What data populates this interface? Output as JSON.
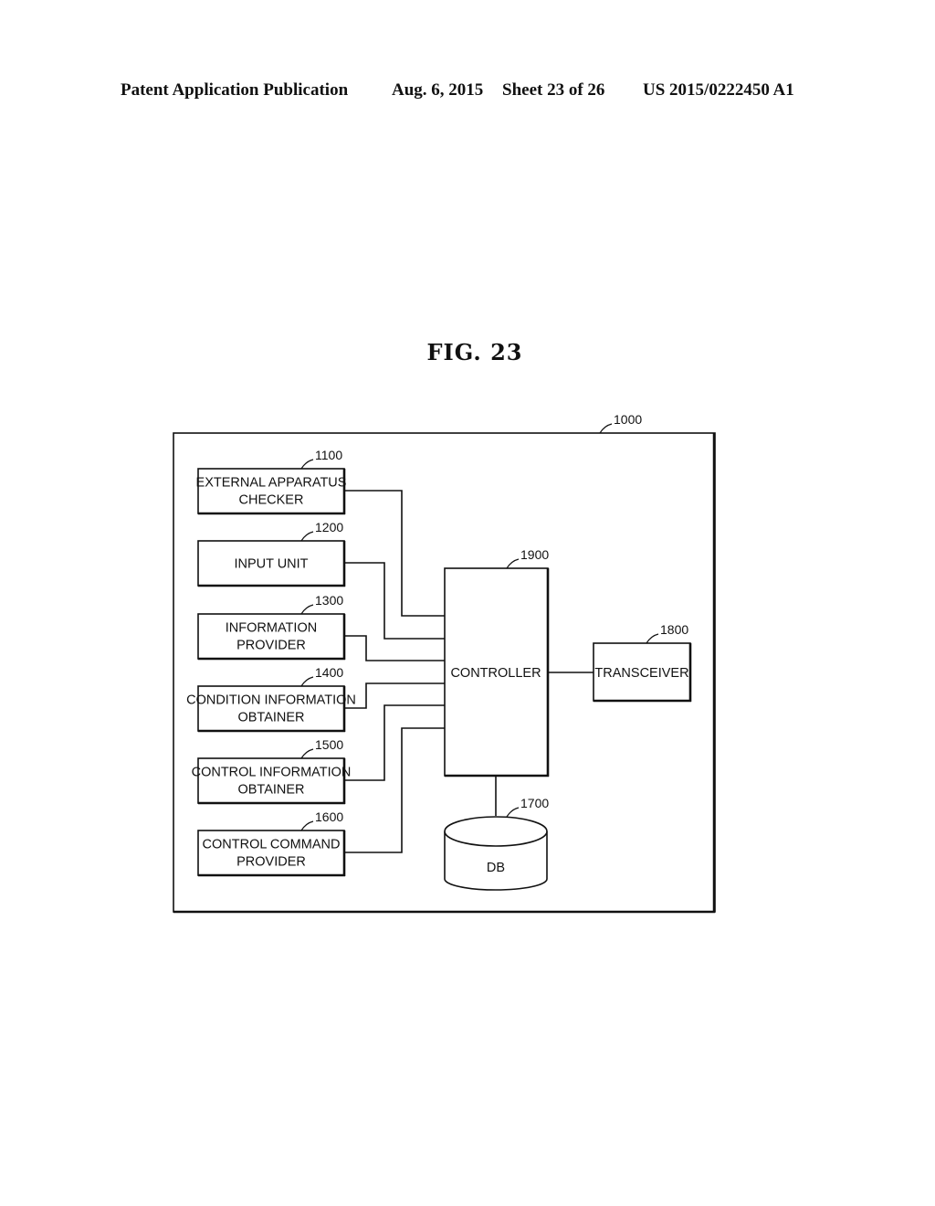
{
  "header": {
    "publication": "Patent Application Publication",
    "date": "Aug. 6, 2015",
    "sheet": "Sheet 23 of 26",
    "number": "US 2015/0222450 A1"
  },
  "figure": {
    "title": "FIG.  23",
    "system": {
      "ref": "1000"
    },
    "modules": [
      {
        "ref": "1100",
        "lines": [
          "EXTERNAL APPARATUS",
          "CHECKER"
        ]
      },
      {
        "ref": "1200",
        "lines": [
          "INPUT UNIT"
        ]
      },
      {
        "ref": "1300",
        "lines": [
          "INFORMATION",
          "PROVIDER"
        ]
      },
      {
        "ref": "1400",
        "lines": [
          "CONDITION INFORMATION",
          "OBTAINER"
        ]
      },
      {
        "ref": "1500",
        "lines": [
          "CONTROL INFORMATION",
          "OBTAINER"
        ]
      },
      {
        "ref": "1600",
        "lines": [
          "CONTROL COMMAND",
          "PROVIDER"
        ]
      }
    ],
    "controller": {
      "ref": "1900",
      "label": "CONTROLLER"
    },
    "transceiver": {
      "ref": "1800",
      "label": "TRANSCEIVER"
    },
    "database": {
      "ref": "1700",
      "label": "DB"
    }
  }
}
